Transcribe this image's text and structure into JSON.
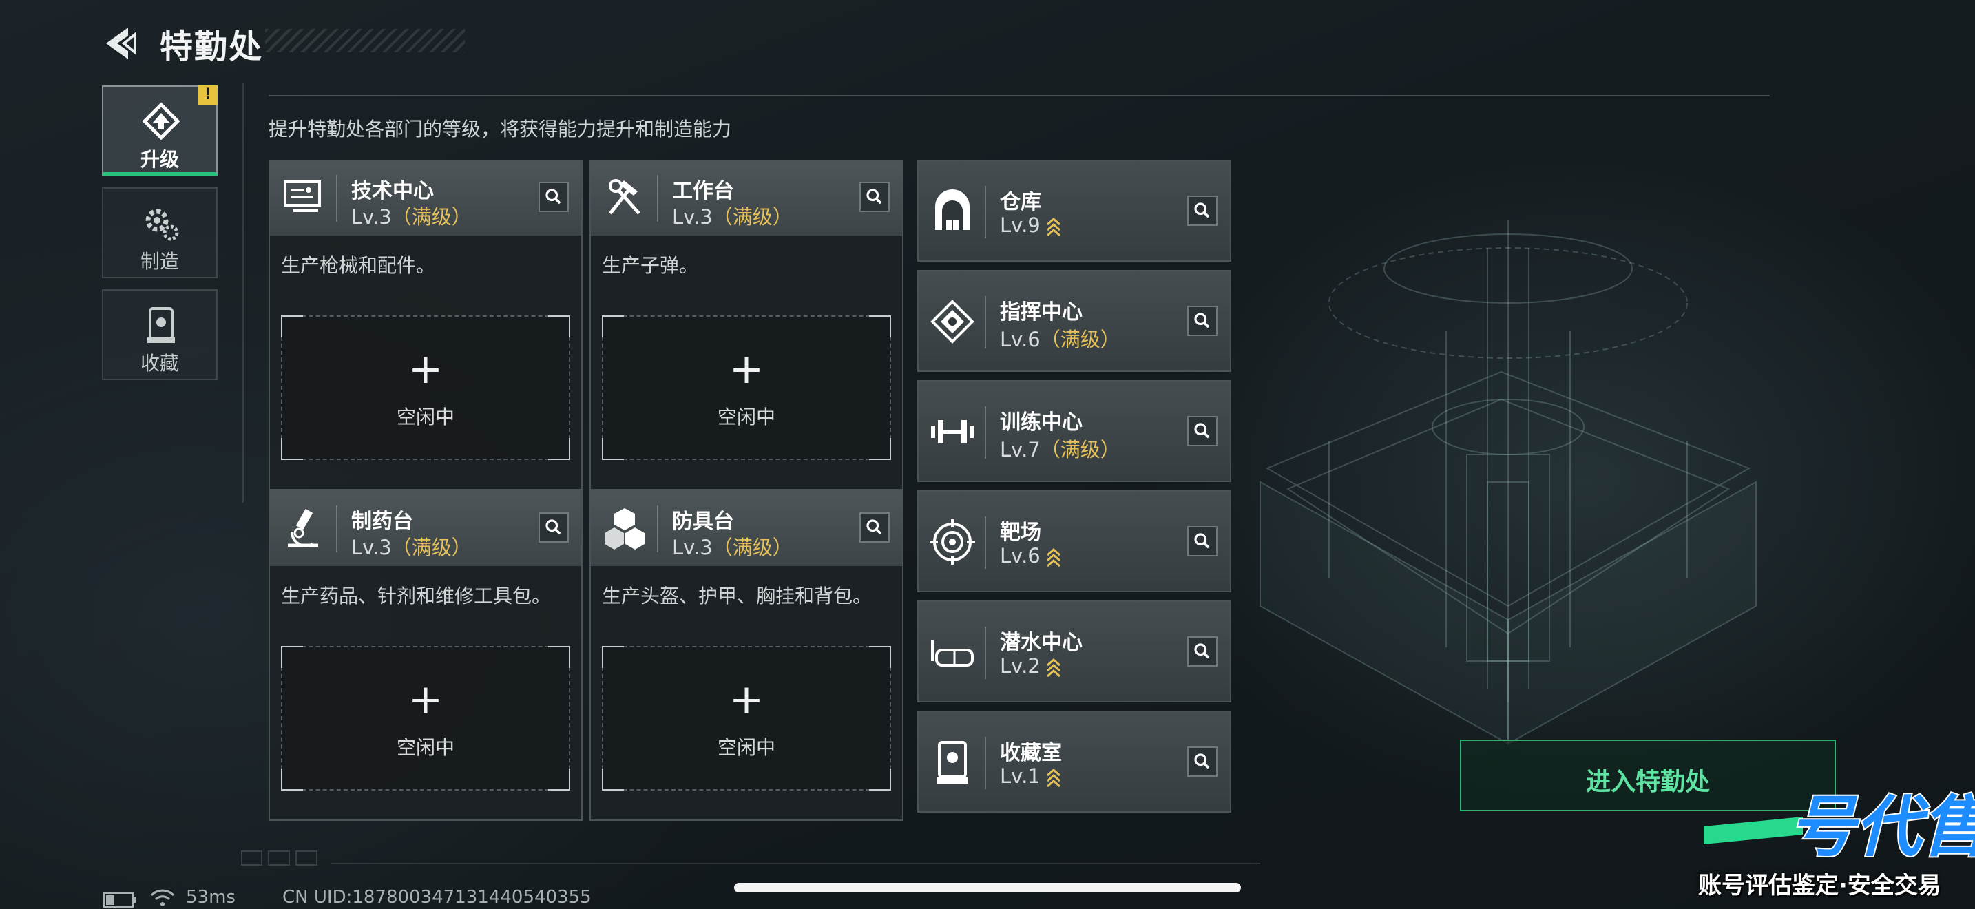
{
  "header": {
    "title": "特勤处",
    "back_icon": "back-arrow-icon"
  },
  "side_tabs": [
    {
      "label": "升级",
      "icon": "upgrade-icon",
      "active": true,
      "badge": "!"
    },
    {
      "label": "制造",
      "icon": "gears-icon",
      "active": false
    },
    {
      "label": "收藏",
      "icon": "trophy-case-icon",
      "active": false
    }
  ],
  "subtitle": "提升特勤处各部门的等级，将获得能力提升和制造能力",
  "departments": [
    {
      "name": "技术中心",
      "level": "Lv.3",
      "max": "（满级）",
      "desc": "生产枪械和配件。",
      "slot_plus": "+",
      "slot_status": "空闲中",
      "icon": "monitor-icon"
    },
    {
      "name": "工作台",
      "level": "Lv.3",
      "max": "（满级）",
      "desc": "生产子弹。",
      "slot_plus": "+",
      "slot_status": "空闲中",
      "icon": "hammer-wrench-icon"
    },
    {
      "name": "制药台",
      "level": "Lv.3",
      "max": "（满级）",
      "desc": "生产药品、针剂和维修工具包。",
      "slot_plus": "+",
      "slot_status": "空闲中",
      "icon": "microscope-icon"
    },
    {
      "name": "防具台",
      "level": "Lv.3",
      "max": "（满级）",
      "desc": "生产头盔、护甲、胸挂和背包。",
      "slot_plus": "+",
      "slot_status": "空闲中",
      "icon": "cubes-icon"
    }
  ],
  "facilities": [
    {
      "name": "仓库",
      "level": "Lv.9",
      "max": "",
      "upgradeable": true,
      "icon": "warehouse-icon"
    },
    {
      "name": "指挥中心",
      "level": "Lv.6",
      "max": "（满级）",
      "upgradeable": false,
      "icon": "chip-icon"
    },
    {
      "name": "训练中心",
      "level": "Lv.7",
      "max": "（满级）",
      "upgradeable": false,
      "icon": "dumbbell-icon"
    },
    {
      "name": "靶场",
      "level": "Lv.6",
      "max": "",
      "upgradeable": true,
      "icon": "target-icon"
    },
    {
      "name": "潜水中心",
      "level": "Lv.2",
      "max": "",
      "upgradeable": true,
      "icon": "diving-mask-icon"
    },
    {
      "name": "收藏室",
      "level": "Lv.1",
      "max": "",
      "upgradeable": true,
      "icon": "display-case-icon"
    }
  ],
  "enter_button": "进入特勤处",
  "status_bar": {
    "ping": "53ms",
    "uid": "CN UID:187800347131440540355"
  },
  "watermark": {
    "logo_text": "一号代售",
    "slogan": "账号评估鉴定·安全交易"
  },
  "colors": {
    "accent_green": "#29c27d",
    "max_level_gold": "#e6c15a",
    "warning_yellow": "#e8c33e"
  }
}
